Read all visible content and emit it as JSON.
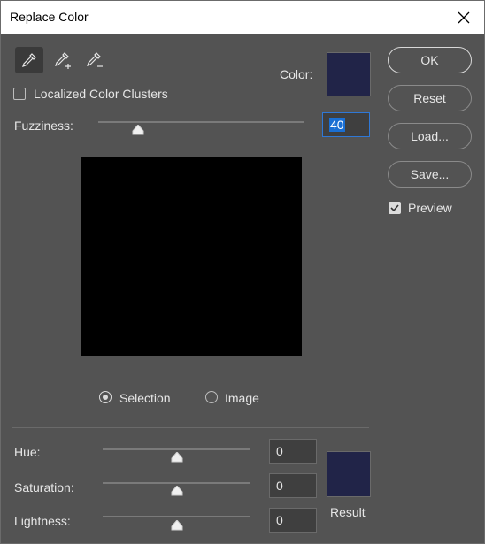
{
  "window": {
    "title": "Replace Color"
  },
  "tools": [
    {
      "name": "eyedropper-tool",
      "icon": "eyedropper-icon"
    },
    {
      "name": "eyedropper-add-tool",
      "icon": "eyedropper-plus-icon"
    },
    {
      "name": "eyedropper-subtract-tool",
      "icon": "eyedropper-minus-icon"
    }
  ],
  "color_label": "Color:",
  "localized": {
    "label": "Localized Color Clusters",
    "checked": false
  },
  "fuzziness": {
    "label": "Fuzziness:",
    "value": "40",
    "slider_fraction": 0.2
  },
  "radios": {
    "selection": {
      "label": "Selection",
      "checked": true
    },
    "image": {
      "label": "Image",
      "checked": false
    }
  },
  "buttons": {
    "ok": "OK",
    "reset": "Reset",
    "load": "Load...",
    "save": "Save..."
  },
  "preview": {
    "label": "Preview",
    "checked": true
  },
  "adjust": {
    "hue": {
      "label": "Hue:",
      "value": "0"
    },
    "saturation": {
      "label": "Saturation:",
      "value": "0"
    },
    "lightness": {
      "label": "Lightness:",
      "value": "0"
    }
  },
  "result_label": "Result",
  "colors": {
    "swatch": "#212448",
    "accent": "#1a6fd3"
  }
}
